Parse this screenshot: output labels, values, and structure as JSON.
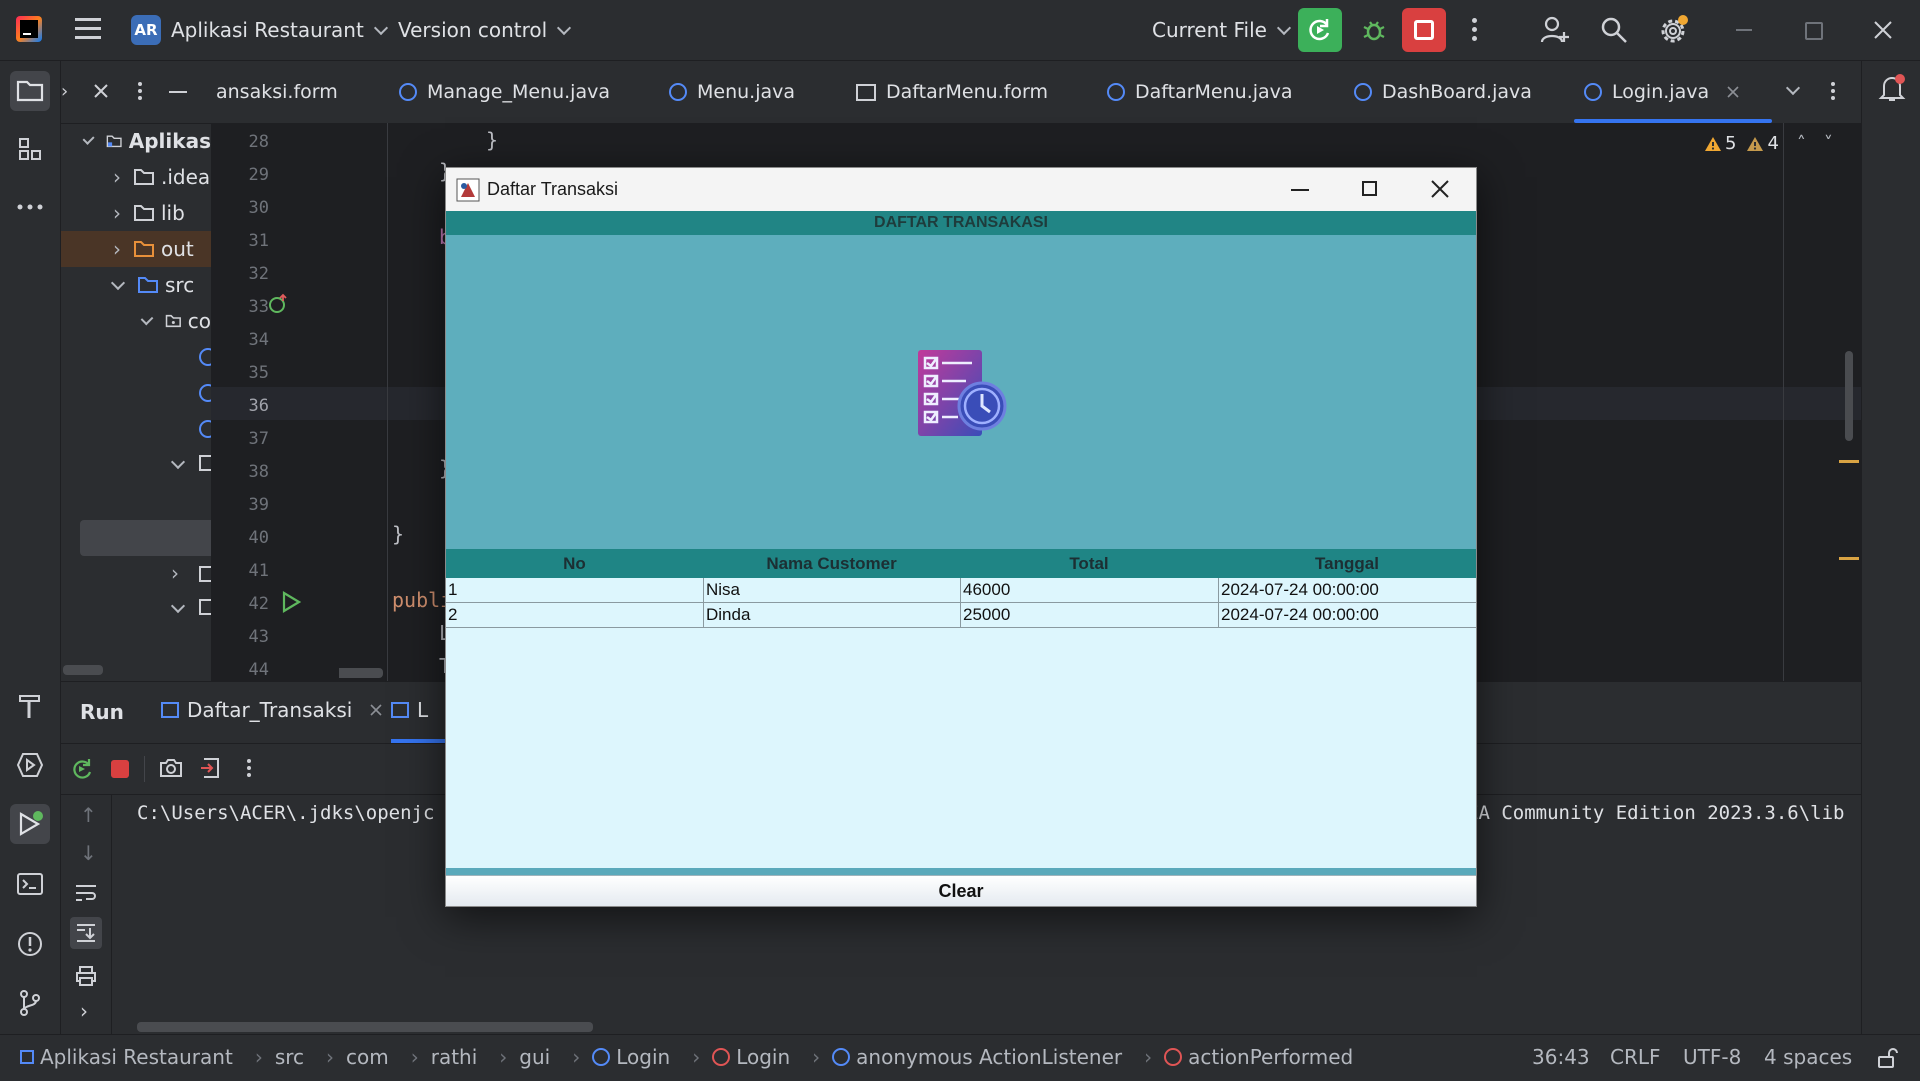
{
  "titlebar": {
    "project_badge": "AR",
    "project_name": "Aplikasi Restaurant",
    "vcs_label": "Version control",
    "run_config": "Current File"
  },
  "colors": {
    "accent": "#3574f0",
    "run_green": "#3cb05a",
    "stop_red": "#d94040",
    "dialog_header": "#218585",
    "dialog_bg": "#59a9bc",
    "table_body": "#ddf6fd"
  },
  "tabs": [
    {
      "label": "ansaksi.form",
      "icon": "form-icon"
    },
    {
      "label": "Manage_Menu.java",
      "icon": "class-icon"
    },
    {
      "label": "Menu.java",
      "icon": "class-icon"
    },
    {
      "label": "DaftarMenu.form",
      "icon": "form-icon"
    },
    {
      "label": "DaftarMenu.java",
      "icon": "class-icon"
    },
    {
      "label": "DashBoard.java",
      "icon": "class-icon"
    },
    {
      "label": "Login.java",
      "icon": "class-icon",
      "active": true
    }
  ],
  "inspections": {
    "warnings": "5",
    "weak_warnings": "4"
  },
  "project_tree": [
    {
      "label": "Aplikas",
      "bold": true
    },
    {
      "label": ".idea"
    },
    {
      "label": "lib"
    },
    {
      "label": "out"
    },
    {
      "label": "src"
    },
    {
      "label": "co"
    }
  ],
  "editor": {
    "line_numbers": [
      "28",
      "29",
      "30",
      "31",
      "32",
      "33",
      "34",
      "35",
      "36",
      "37",
      "38",
      "39",
      "40",
      "41",
      "42",
      "43",
      "44"
    ],
    "current_line": "36",
    "code": {
      "l28": "}",
      "l29": "}",
      "l31": "b",
      "l38": "}",
      "l40": "}",
      "l42": "publi",
      "l43": "L",
      "l44": "T"
    }
  },
  "run_panel": {
    "run_label": "Run",
    "tab_1": "Daftar_Transaksi",
    "tab_2": "L",
    "console_left": "C:\\Users\\ACER\\.jdks\\openjc",
    "console_right": "EA Community Edition 2023.3.6\\lib"
  },
  "statusbar": {
    "crumbs": [
      "Aplikasi Restaurant",
      "src",
      "com",
      "rathi",
      "gui",
      "Login",
      "Login",
      "anonymous ActionListener",
      "actionPerformed"
    ],
    "position": "36:43",
    "line_sep": "CRLF",
    "encoding": "UTF-8",
    "indent": "4 spaces"
  },
  "dialog": {
    "title": "Daftar Transaksi",
    "header": "DAFTAR TRANSAKASI",
    "columns": [
      "No",
      "Nama Customer",
      "Total",
      "Tanggal"
    ],
    "rows": [
      [
        "1",
        "Nisa",
        "46000",
        "2024-07-24 00:00:00"
      ],
      [
        "2",
        "Dinda",
        "25000",
        "2024-07-24 00:00:00"
      ]
    ],
    "clear_button": "Clear"
  }
}
